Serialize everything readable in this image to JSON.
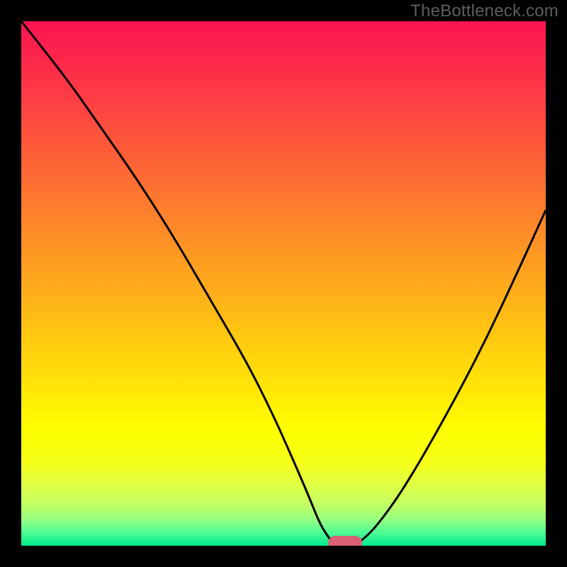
{
  "watermark": "TheBottleneck.com",
  "colors": {
    "frame": "#000000",
    "gradient_stops": [
      {
        "offset": 0.0,
        "color": "#fc1451"
      },
      {
        "offset": 0.1,
        "color": "#fd2f49"
      },
      {
        "offset": 0.2,
        "color": "#fd4e3e"
      },
      {
        "offset": 0.3,
        "color": "#fd6c33"
      },
      {
        "offset": 0.4,
        "color": "#fe8b28"
      },
      {
        "offset": 0.5,
        "color": "#fea91c"
      },
      {
        "offset": 0.6,
        "color": "#ffc811"
      },
      {
        "offset": 0.7,
        "color": "#ffe606"
      },
      {
        "offset": 0.78,
        "color": "#ffff00"
      },
      {
        "offset": 0.84,
        "color": "#f6ff18"
      },
      {
        "offset": 0.88,
        "color": "#e3ff40"
      },
      {
        "offset": 0.92,
        "color": "#c4ff62"
      },
      {
        "offset": 0.95,
        "color": "#96ff80"
      },
      {
        "offset": 0.975,
        "color": "#4dfd94"
      },
      {
        "offset": 1.0,
        "color": "#00e98b"
      }
    ],
    "curve": "#000000",
    "marker": "#d96074"
  },
  "chart_data": {
    "type": "line",
    "title": "",
    "xlabel": "",
    "ylabel": "",
    "xlim": [
      0,
      100
    ],
    "ylim": [
      0,
      100
    ],
    "grid": false,
    "series": [
      {
        "name": "bottleneck-curve",
        "x": [
          0,
          8,
          15,
          22,
          29,
          36,
          43,
          48,
          52,
          55,
          57,
          59,
          60,
          63,
          65,
          68,
          73,
          80,
          88,
          95,
          100
        ],
        "y": [
          100,
          90,
          80,
          70,
          59,
          47,
          35,
          25,
          16,
          9,
          4,
          1,
          0,
          0,
          1,
          4,
          11,
          23,
          38,
          53,
          64
        ]
      }
    ],
    "marker": {
      "x_start": 58.5,
      "x_end": 65.0,
      "y": 0
    }
  }
}
